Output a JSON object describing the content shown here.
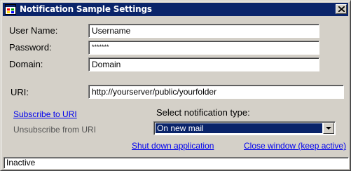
{
  "window": {
    "title": "Notification Sample Settings"
  },
  "form": {
    "username": {
      "label": "User Name:",
      "value": "Username"
    },
    "password": {
      "label": "Password:",
      "value": "*******"
    },
    "domain": {
      "label": "Domain:",
      "value": "Domain"
    },
    "uri": {
      "label": "URI:",
      "value": "http://yourserver/public/yourfolder"
    }
  },
  "actions": {
    "subscribe": "Subscribe to URI",
    "unsubscribe": "Unsubscribe from URI",
    "shutdown": "Shut down application",
    "close_window": "Close window (keep active)"
  },
  "notification": {
    "label": "Select notification type:",
    "selected": "On new mail"
  },
  "status": {
    "text": "Inactive"
  },
  "icons": {
    "app": "app-window-icon",
    "close": "close-icon",
    "dropdown": "chevron-down-icon"
  }
}
